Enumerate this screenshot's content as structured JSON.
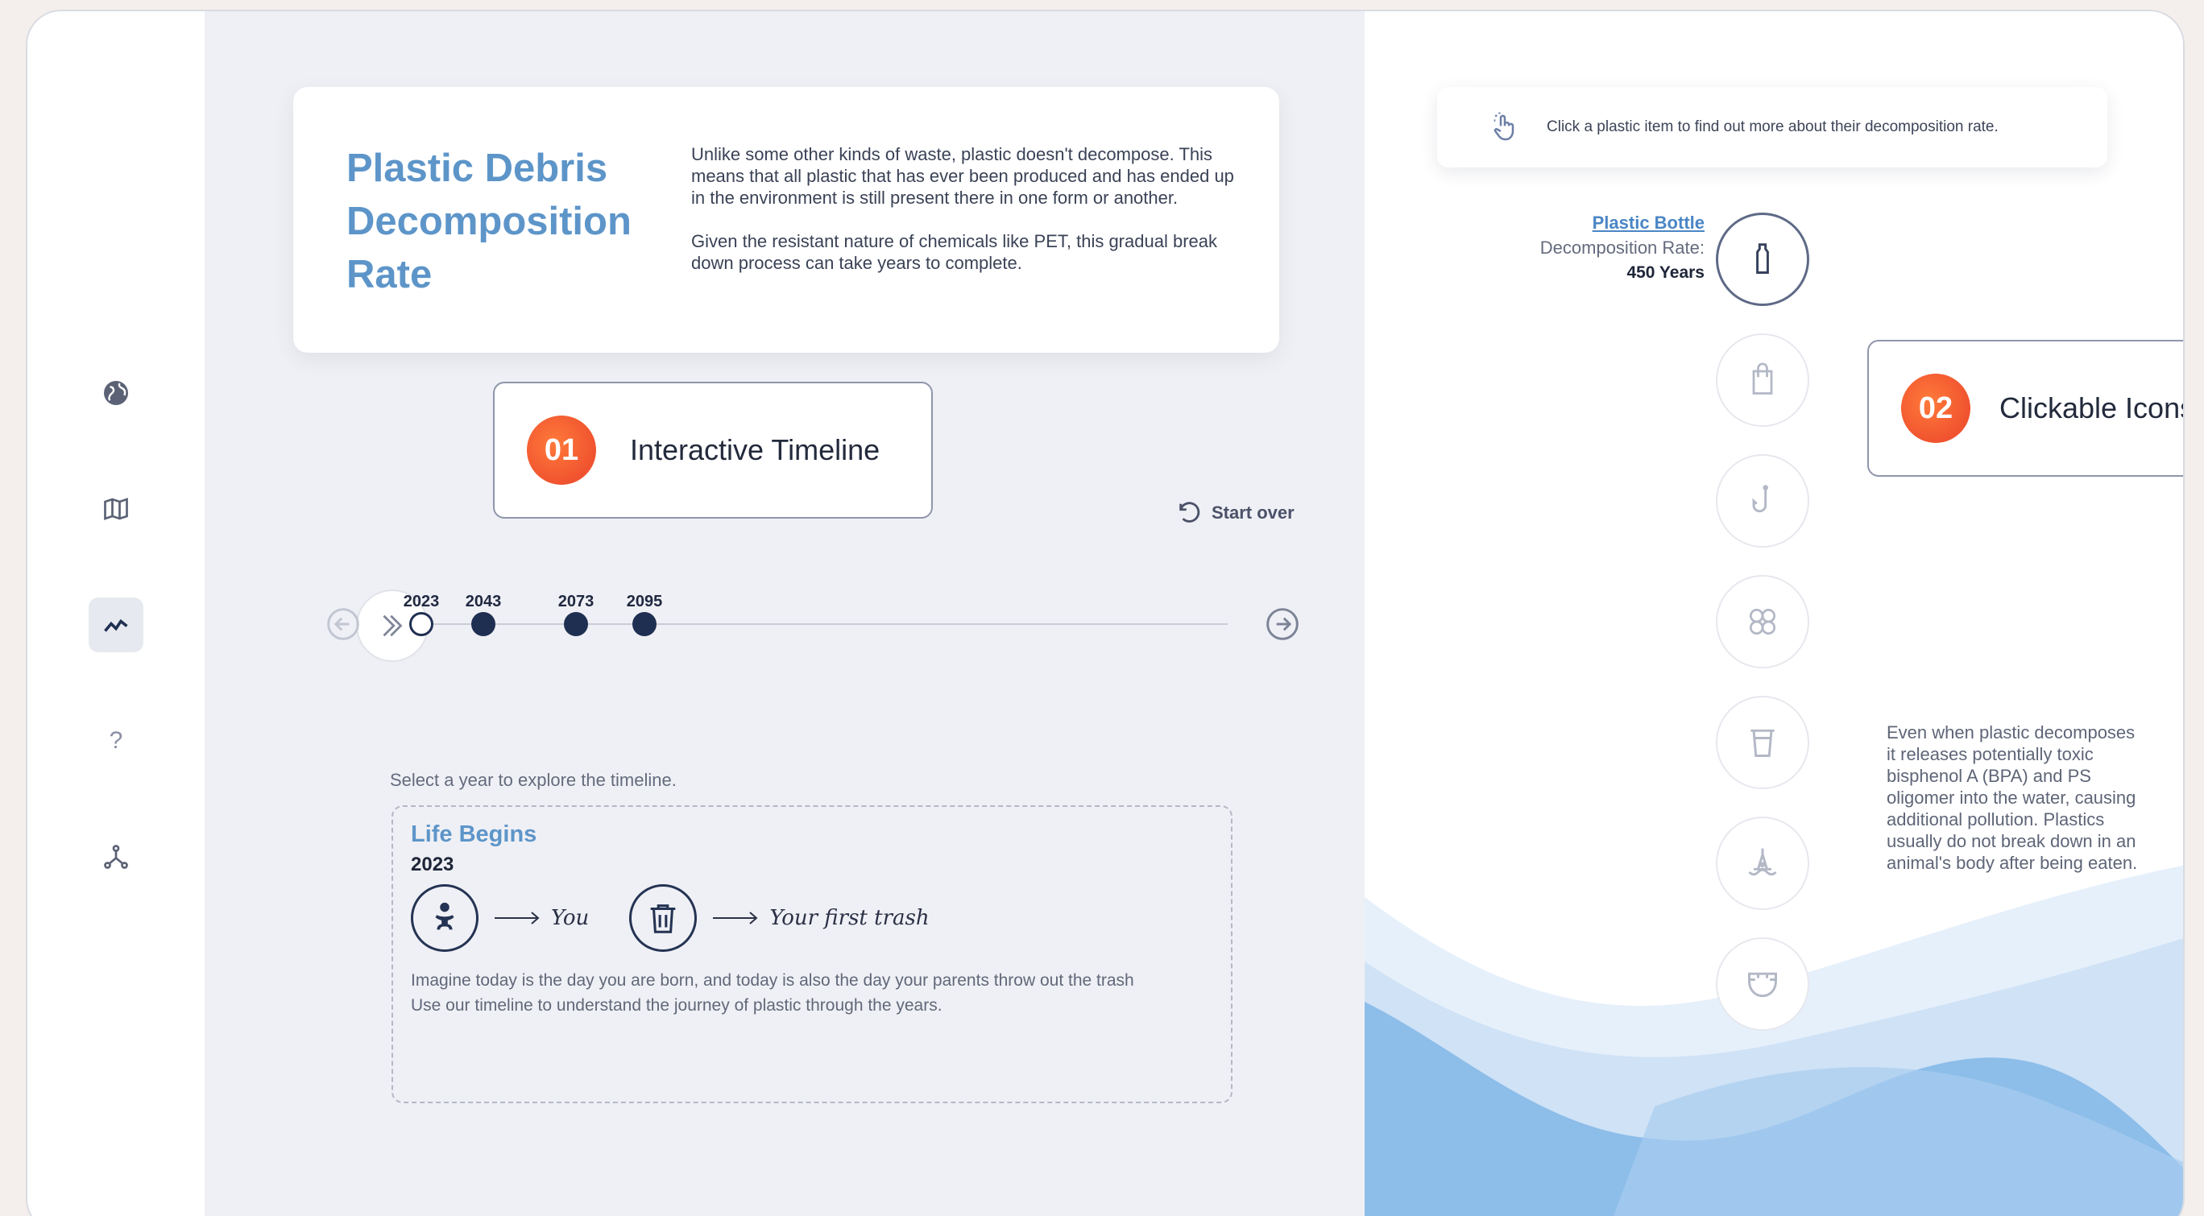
{
  "intro": {
    "title": "Plastic Debris Decomposition Rate",
    "paragraph1": "Unlike some other kinds of waste, plastic doesn't decompose. This means that all plastic that has ever been produced and has ended up in the environment is still present there in one form or another.",
    "paragraph2": "Given the resistant nature of chemicals like PET, this gradual break down process can take years to complete."
  },
  "callouts": [
    {
      "number": "01",
      "label": "Interactive Timeline"
    },
    {
      "number": "02",
      "label": "Clickable Icons"
    }
  ],
  "rail": {
    "icons": [
      "globe-icon",
      "map-icon",
      "trend-icon",
      "help-icon",
      "network-icon"
    ],
    "active": "trend-icon",
    "help_glyph": "?"
  },
  "timeline": {
    "start_over_label": "Start over",
    "years": [
      "2023",
      "2043",
      "2073",
      "2095"
    ],
    "selected_year": "2023",
    "select_hint": "Select a year to explore the timeline."
  },
  "event": {
    "title": "Life Begins",
    "year": "2023",
    "you_label": "You",
    "trash_label": "Your first trash",
    "description_line1": "Imagine today is the day you are born, and today is also the day your parents throw out the trash",
    "description_line2": "Use our timeline to understand the journey of plastic through the years."
  },
  "panel": {
    "hint": "Click a plastic item to find out more about their decomposition rate.",
    "items": [
      "bottle-icon",
      "bag-icon",
      "hook-icon",
      "six-pack-ring-icon",
      "cup-icon",
      "buoy-icon",
      "diaper-icon"
    ],
    "selected_item": {
      "name": "Plastic Bottle",
      "rate_label": "Decomposition Rate:",
      "rate": "450 Years"
    },
    "note": "Even when plastic decomposes it releases potentially toxic bisphenol A (BPA) and PS oligomer into the water, causing additional pollution. Plastics usually do not break down in an animal's body after being eaten."
  },
  "colors": {
    "accent_blue": "#5d95c9",
    "navy": "#1f2f52",
    "badge_orange": "#f0532f",
    "wave_light": "#dcebfa",
    "wave_dark": "#8dbde9"
  }
}
